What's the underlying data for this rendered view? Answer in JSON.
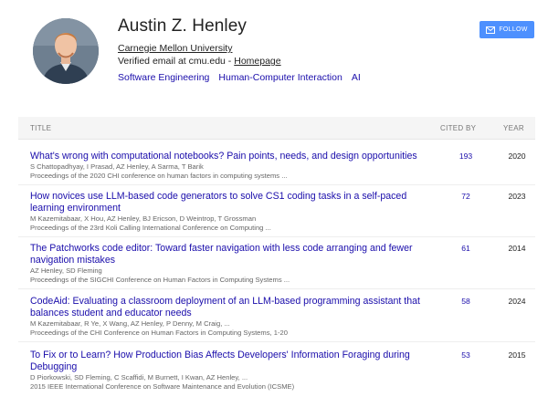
{
  "profile": {
    "name": "Austin Z. Henley",
    "affiliation": "Carnegie Mellon University",
    "email_prefix": "Verified email at cmu.edu - ",
    "homepage_label": "Homepage",
    "interests": [
      "Software Engineering",
      "Human-Computer Interaction",
      "AI"
    ],
    "follow_label": "FOLLOW"
  },
  "table": {
    "headers": {
      "title": "TITLE",
      "cited_by": "CITED BY",
      "year": "YEAR"
    },
    "rows": [
      {
        "title": "What's wrong with computational notebooks? Pain points, needs, and design opportunities",
        "authors": "S Chattopadhyay, I Prasad, AZ Henley, A Sarma, T Barik",
        "venue": "Proceedings of the 2020 CHI conference on human factors in computing systems ...",
        "cited_by": "193",
        "year": "2020"
      },
      {
        "title": "How novices use LLM-based code generators to solve CS1 coding tasks in a self-paced learning environment",
        "authors": "M Kazemitabaar, X Hou, AZ Henley, BJ Ericson, D Weintrop, T Grossman",
        "venue": "Proceedings of the 23rd Koli Calling International Conference on Computing ...",
        "cited_by": "72",
        "year": "2023"
      },
      {
        "title": "The Patchworks code editor: Toward faster navigation with less code arranging and fewer navigation mistakes",
        "authors": "AZ Henley, SD Fleming",
        "venue": "Proceedings of the SIGCHI Conference on Human Factors in Computing Systems ...",
        "cited_by": "61",
        "year": "2014"
      },
      {
        "title": "CodeAid: Evaluating a classroom deployment of an LLM-based programming assistant that balances student and educator needs",
        "authors": "M Kazemitabaar, R Ye, X Wang, AZ Henley, P Denny, M Craig, ...",
        "venue": "Proceedings of the CHI Conference on Human Factors in Computing Systems, 1-20",
        "cited_by": "58",
        "year": "2024"
      },
      {
        "title": "To Fix or to Learn? How Production Bias Affects Developers' Information Foraging during Debugging",
        "authors": "D Piorkowski, SD Fleming, C Scaffidi, M Burnett, I Kwan, AZ Henley, ...",
        "venue": "2015 IEEE International Conference on Software Maintenance and Evolution (ICSME)",
        "cited_by": "53",
        "year": "2015"
      }
    ]
  },
  "colors": {
    "link": "#1a0dab",
    "follow_button": "#4d90fe",
    "header_bg": "#f5f5f5"
  }
}
